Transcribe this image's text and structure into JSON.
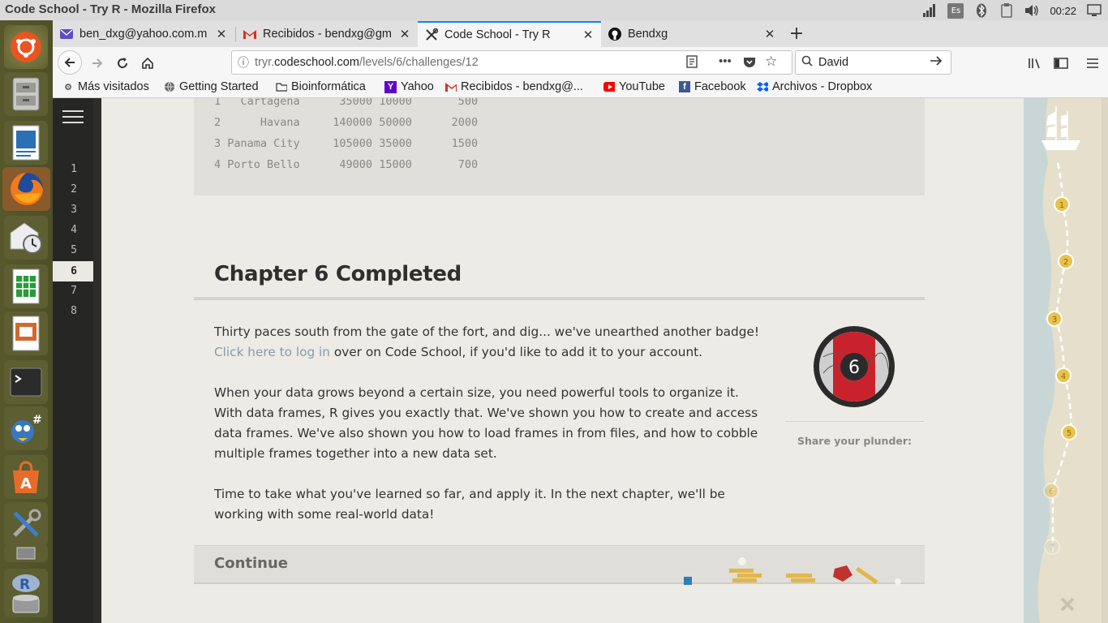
{
  "window": {
    "title": "Code School - Try R - Mozilla Firefox"
  },
  "tray": {
    "keyboard": "Es",
    "clock": "00:22"
  },
  "launcher": {
    "items": [
      "ubuntu-icon",
      "files-icon",
      "writer-icon",
      "firefox-icon",
      "mail-clock-icon",
      "calc-icon",
      "impress-icon",
      "terminal-icon",
      "mono-develop-icon",
      "software-center-icon",
      "system-settings-icon",
      "workspace-icon",
      "r-icon"
    ]
  },
  "tabs": [
    {
      "label": "ben_dxg@yahoo.com.m",
      "icon": "yahoo-mail-icon"
    },
    {
      "label": "Recibidos - bendxg@gm",
      "icon": "gmail-icon"
    },
    {
      "label": "Code School - Try R",
      "icon": "tools-icon"
    },
    {
      "label": "Bendxg",
      "icon": "github-icon"
    }
  ],
  "navbar": {
    "url_prefix": "tryr.",
    "url_domain": "codeschool.com",
    "url_path": "/levels/6/challenges/12",
    "search_value": "David"
  },
  "bookmarks": [
    {
      "label": "Más visitados",
      "icon": "gear-icon"
    },
    {
      "label": "Getting Started",
      "icon": "globe-icon"
    },
    {
      "label": "Bioinformática",
      "icon": "folder-icon"
    },
    {
      "label": "Yahoo",
      "icon": "yahoo-icon"
    },
    {
      "label": "Recibidos - bendxg@...",
      "icon": "gmail-icon"
    },
    {
      "label": "YouTube",
      "icon": "youtube-icon"
    },
    {
      "label": "Facebook",
      "icon": "facebook-icon"
    },
    {
      "label": "Archivos - Dropbox",
      "icon": "dropbox-icon"
    }
  ],
  "editor": {
    "line_numbers": [
      "1",
      "2",
      "3",
      "4",
      "5",
      "6",
      "7",
      "8"
    ],
    "active_line": "6"
  },
  "output": {
    "rows": [
      "1   Cartagena      35000 10000       500",
      "2      Havana     140000 50000      2000",
      "3 Panama City     105000 35000      1500",
      "4 Porto Bello      49000 15000       700"
    ]
  },
  "chapter": {
    "title": "Chapter 6 Completed",
    "p1_text": "Thirty paces south from the gate of the fort, and dig... we've unearthed another badge! ",
    "p1_link": "Click here to log in",
    "p1_tail": " over on Code School, if you'd like to add it to your account.",
    "p2": "When your data grows beyond a certain size, you need powerful tools to organize it. With data frames, R gives you exactly that. We've shown you how to create and access data frames. We've also shown you how to load frames in from files, and how to cobble multiple frames together into a new data set.",
    "p3": "Time to take what you've learned so far, and apply it. In the next chapter, we'll be working with some real-world data!",
    "badge_number": "6",
    "share_label": "Share your plunder:",
    "continue_label": "Continue"
  },
  "map": {
    "markers": [
      "1",
      "2",
      "3",
      "4",
      "5",
      "6",
      "7"
    ],
    "completed": [
      "1",
      "2",
      "3",
      "4",
      "5"
    ]
  }
}
